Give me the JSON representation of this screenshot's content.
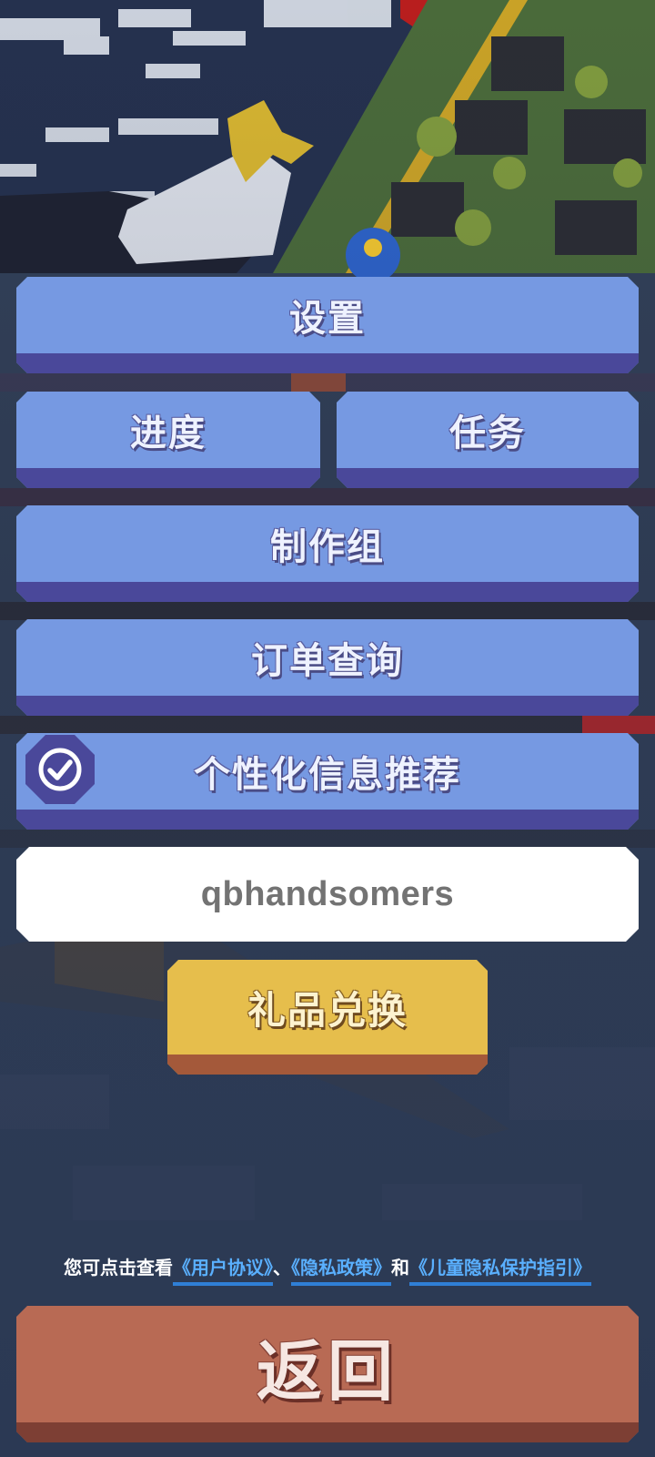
{
  "menu": {
    "settings_label": "设置",
    "progress_label": "进度",
    "tasks_label": "任务",
    "credits_label": "制作组",
    "orders_label": "订单查询",
    "recommend_label": "个性化信息推荐",
    "recommend_checked": true
  },
  "redeem": {
    "code_value": "qbhandsomers",
    "button_label": "礼品兑换"
  },
  "policy": {
    "prefix": "您可点击查看",
    "user_agreement": "《用户协议》",
    "separator": "、",
    "privacy_policy": "《隐私政策》",
    "conjunction": "和",
    "child_privacy": "《儿童隐私保护指引》"
  },
  "back_label": "返回",
  "colors": {
    "menu_button": "#7699e2",
    "menu_button_shadow": "#4a489a",
    "redeem_button": "#e6be4c",
    "back_button": "#b86a54",
    "link": "#5ab0ff"
  }
}
